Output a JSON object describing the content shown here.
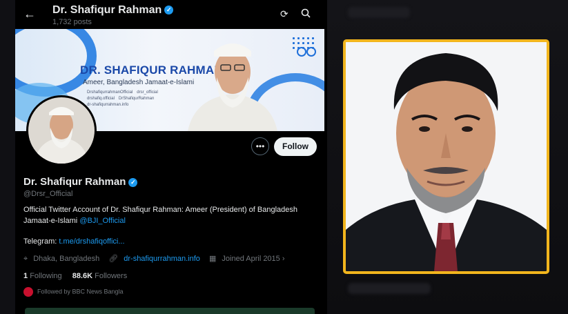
{
  "header": {
    "back_icon": "arrow-left-icon",
    "name": "Dr. Shafiqur Rahman",
    "posts": "1,732 posts",
    "icons": [
      "refresh-icon",
      "search-icon"
    ]
  },
  "banner": {
    "title": "DR. SHAFIQUR RAHMAN",
    "subtitle": "Ameer, Bangladesh Jamaat-e-Islami",
    "links": [
      "DrshafiqurrahmanOfficial",
      "drsr_official",
      "drshafiq.official",
      "DrShafiqurRahman",
      "dr-shafiqurrahman.info"
    ]
  },
  "actions": {
    "more_label": "•••",
    "follow_label": "Follow"
  },
  "profile": {
    "name": "Dr. Shafiqur Rahman",
    "verified": "✓",
    "handle": "@Drsr_Official",
    "bio_text": "Official Twitter Account of Dr. Shafiqur Rahman: Ameer (President) of Bangladesh Jamaat-e-Islami",
    "bio_mention": "@BJI_Official",
    "telegram_label": "Telegram:",
    "telegram_link": "t.me/drshafiqoffici...",
    "location": "Dhaka, Bangladesh",
    "website": "dr-shafiqurrahman.info",
    "joined": "Joined April 2015",
    "following_count": "1",
    "following_label": "Following",
    "followers_count": "88.6K",
    "followers_label": "Followers",
    "followed_by": "Followed by BBC News Bangla"
  },
  "colors": {
    "accent": "#1d9bf0",
    "frame": "#f2b51d",
    "background": "#000000"
  }
}
